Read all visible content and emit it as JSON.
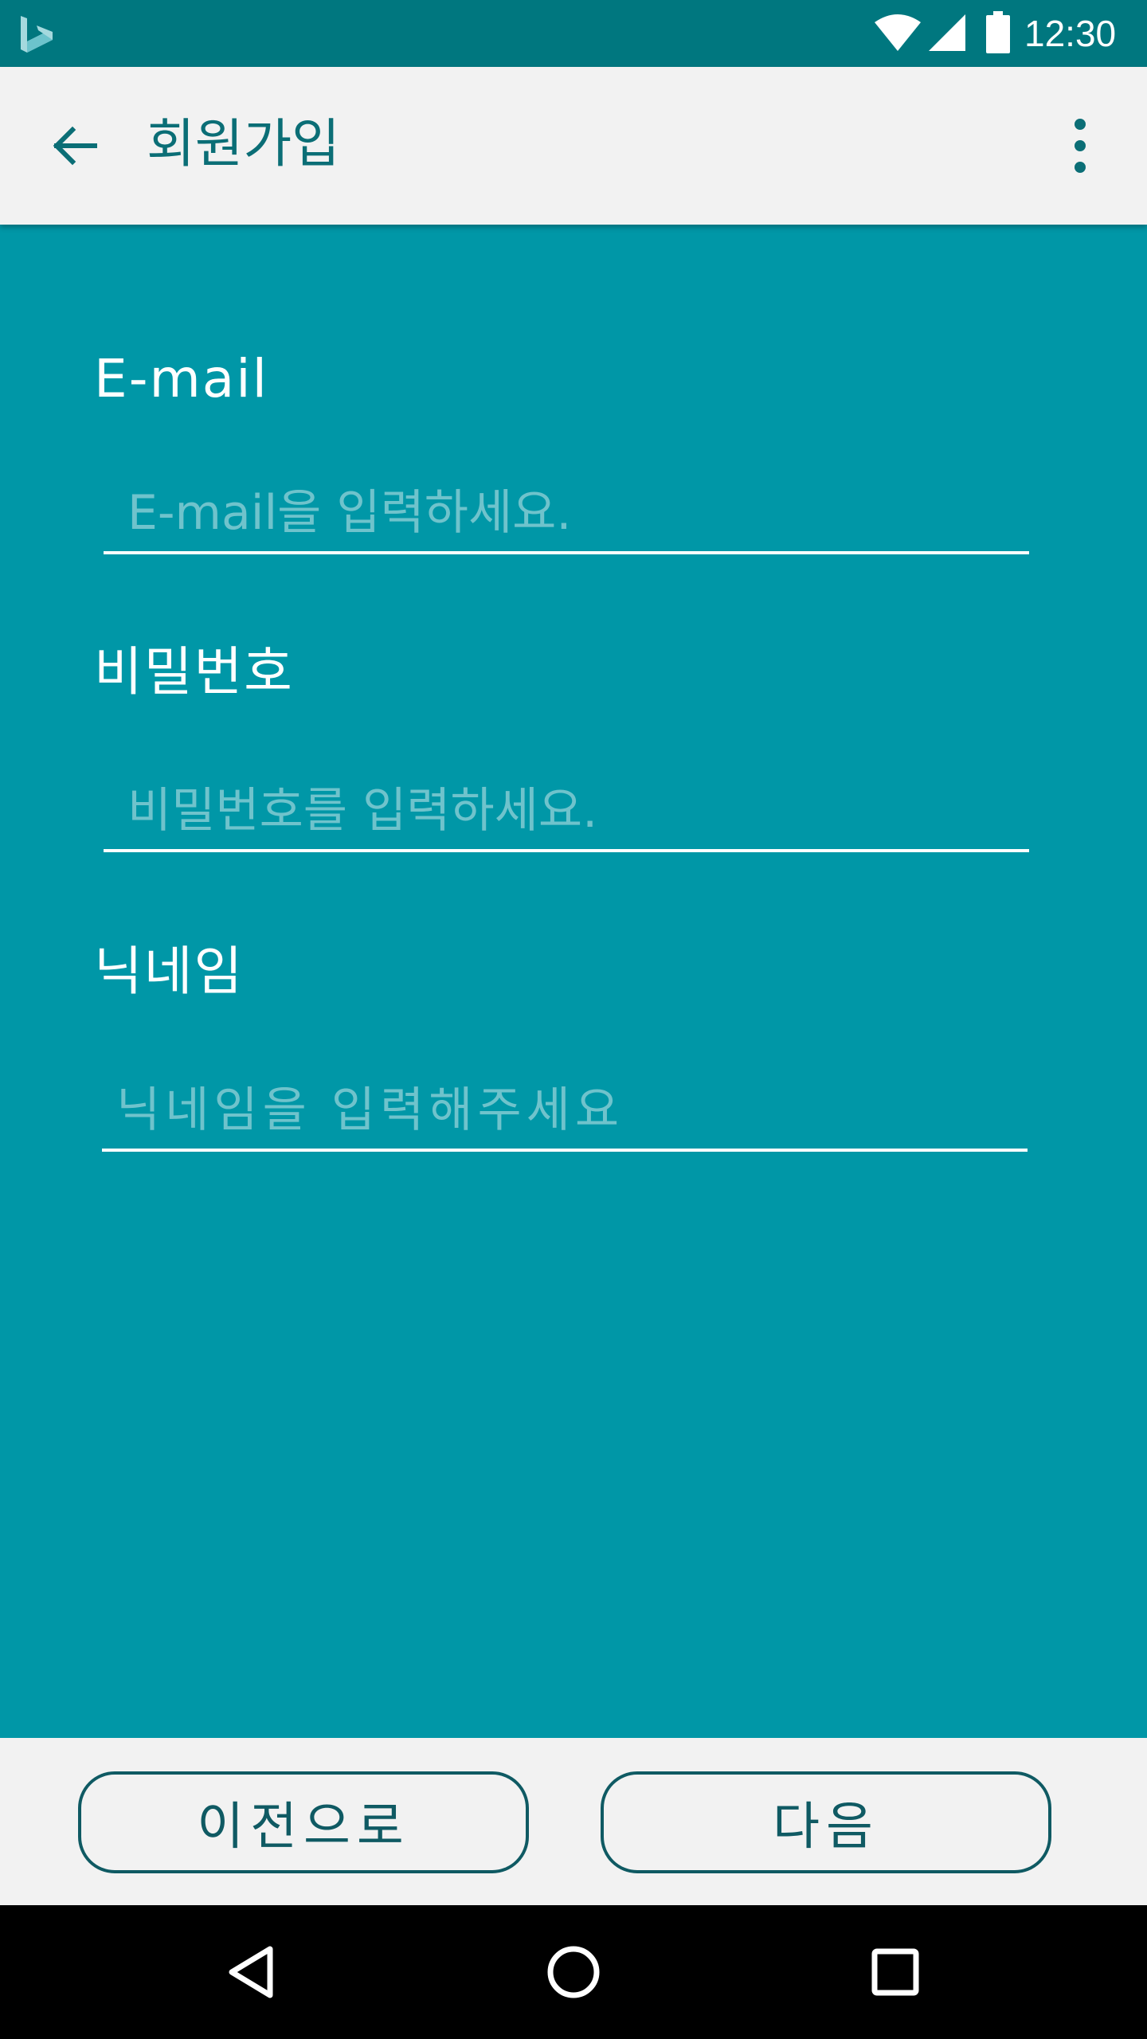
{
  "status_bar": {
    "time": "12:30",
    "icons": [
      "bing-logo-icon",
      "wifi-icon",
      "signal-icon",
      "battery-icon"
    ]
  },
  "app_bar": {
    "title": "회원가입",
    "back_icon": "arrow-back-icon",
    "overflow_icon": "more-vert-icon"
  },
  "form": {
    "email": {
      "label": "E-mail",
      "placeholder": "E-mail을 입력하세요.",
      "value": ""
    },
    "password": {
      "label": "비밀번호",
      "placeholder": "비밀번호를 입력하세요.",
      "value": ""
    },
    "nickname": {
      "label": "닉네임",
      "placeholder": "닉네임을 입력해주세요",
      "value": ""
    }
  },
  "buttons": {
    "prev_label": "이전으로",
    "next_label": "다음"
  },
  "nav_bar": {
    "icons": [
      "nav-back-icon",
      "nav-home-icon",
      "nav-recents-icon"
    ]
  },
  "colors": {
    "background": "#0097a7",
    "status_bar": "#00777f",
    "app_bar": "#f2f2f2",
    "accent_dark": "#0f5a63",
    "placeholder": "#6fc3cc"
  }
}
